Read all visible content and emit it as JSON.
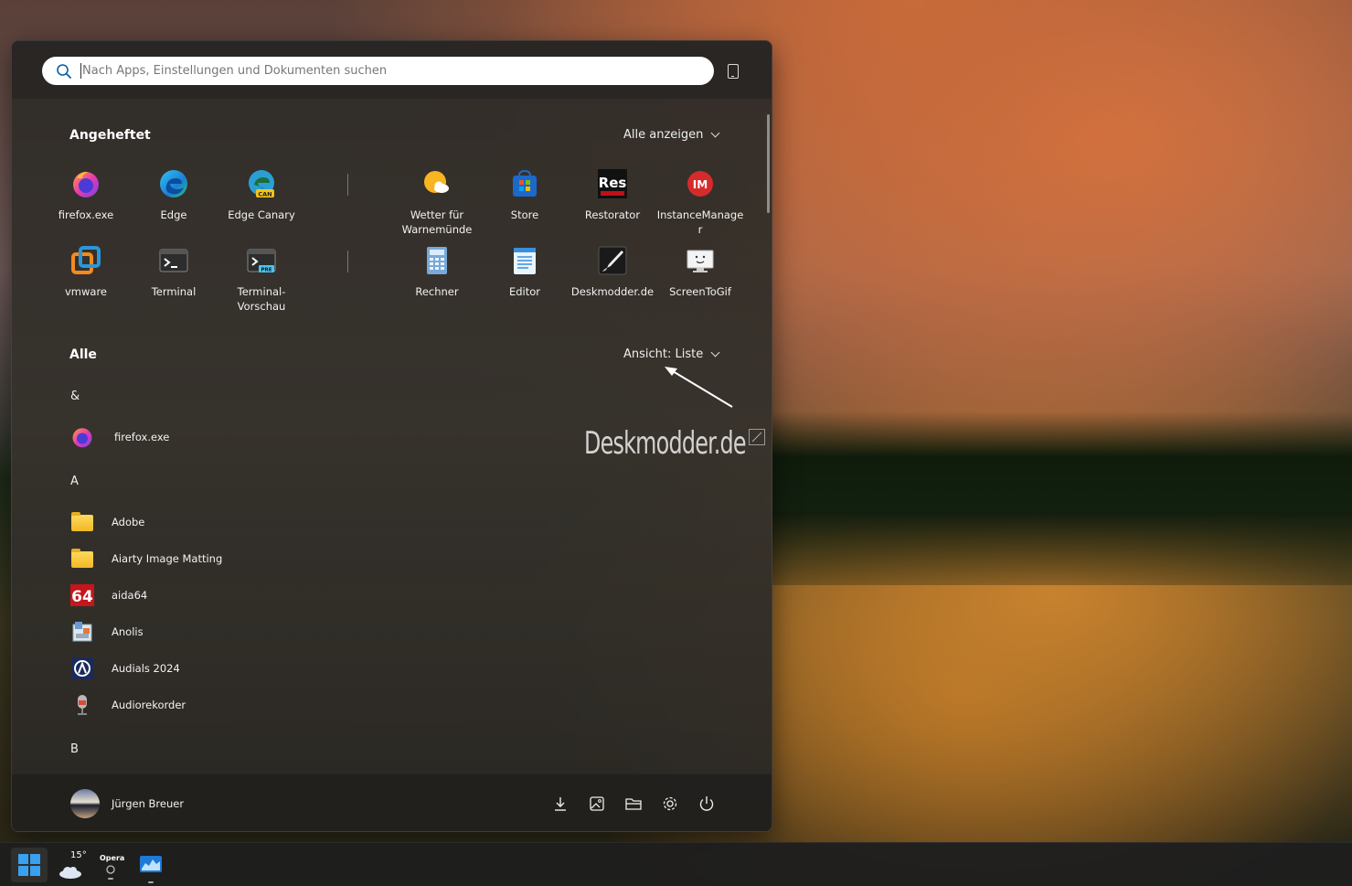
{
  "search": {
    "placeholder": "Nach Apps, Einstellungen und Dokumenten suchen"
  },
  "pinned": {
    "title": "Angeheftet",
    "action": "Alle anzeigen",
    "items": [
      {
        "label": "firefox.exe",
        "icon": "firefox-icon"
      },
      {
        "label": "Edge",
        "icon": "edge-icon"
      },
      {
        "label": "Edge Canary",
        "icon": "edge-canary-icon"
      },
      {
        "label": "Wetter für Warnemünde",
        "icon": "weather-icon"
      },
      {
        "label": "Store",
        "icon": "store-icon"
      },
      {
        "label": "Restorator",
        "icon": "restorator-icon"
      },
      {
        "label": "InstanceManager",
        "icon": "instancemanager-icon"
      },
      {
        "label": "vmware",
        "icon": "vmware-icon"
      },
      {
        "label": "Terminal",
        "icon": "terminal-icon"
      },
      {
        "label": "Terminal-Vorschau",
        "icon": "terminal-preview-icon"
      },
      {
        "label": "Rechner",
        "icon": "calculator-icon"
      },
      {
        "label": "Editor",
        "icon": "notepad-icon"
      },
      {
        "label": "Deskmodder.de",
        "icon": "deskmodder-icon"
      },
      {
        "label": "ScreenToGif",
        "icon": "screentogif-icon"
      }
    ]
  },
  "all": {
    "title": "Alle",
    "action": "Ansicht: Liste",
    "groups": [
      {
        "letter": "&",
        "items": [
          {
            "label": "firefox.exe",
            "icon": "firefox-icon"
          }
        ]
      },
      {
        "letter": "A",
        "items": [
          {
            "label": "Adobe",
            "icon": "folder-icon"
          },
          {
            "label": "Aiarty Image Matting",
            "icon": "folder-icon"
          },
          {
            "label": "aida64",
            "icon": "aida64-icon"
          },
          {
            "label": "Anolis",
            "icon": "anolis-icon"
          },
          {
            "label": "Audials 2024",
            "icon": "audials-icon"
          },
          {
            "label": "Audiorekorder",
            "icon": "audiorecorder-icon"
          }
        ]
      },
      {
        "letter": "B",
        "items": []
      }
    ]
  },
  "watermark": "Deskmodder.de",
  "user": {
    "name": "Jürgen Breuer"
  },
  "footer_buttons": [
    "download-icon",
    "pictures-icon",
    "explorer-icon",
    "settings-icon",
    "power-icon"
  ],
  "taskbar": {
    "weather_temp": "15°",
    "opera_label": "Opera"
  },
  "colors": {
    "accent": "#0078d4",
    "menu_bg": "#302c28"
  }
}
